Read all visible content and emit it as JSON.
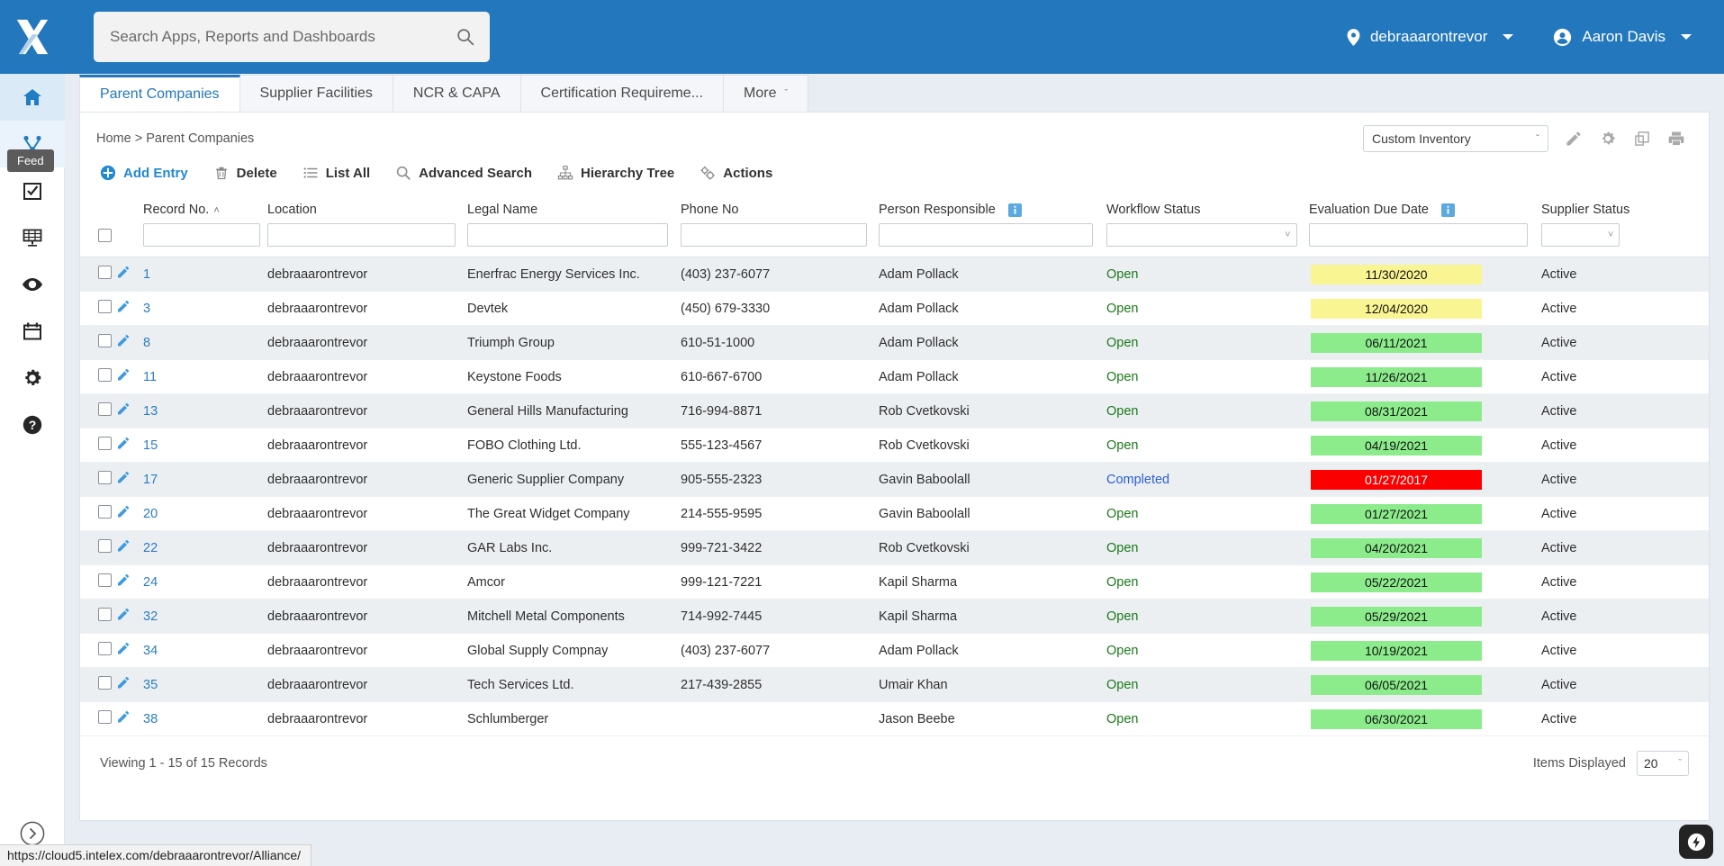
{
  "header": {
    "logo": "x-logo",
    "search": {
      "placeholder": "Search Apps, Reports and Dashboards",
      "value": "",
      "icon": "search-icon"
    },
    "tenant": {
      "label": "debraaarontrevor",
      "icon": "location-pin-icon"
    },
    "user": {
      "label": "Aaron Davis",
      "icon": "user-circle-icon"
    }
  },
  "sidebar": {
    "items": [
      {
        "name": "home",
        "icon": "home-icon",
        "state": "active"
      },
      {
        "name": "feed",
        "icon": "branch-icon",
        "state": "hovered"
      },
      {
        "name": "tasks",
        "icon": "checkbox-icon",
        "state": "default"
      },
      {
        "name": "dashboards",
        "icon": "dashboard-grid-icon",
        "state": "default"
      },
      {
        "name": "views",
        "icon": "eye-icon",
        "state": "default"
      },
      {
        "name": "calendar",
        "icon": "calendar-icon",
        "state": "default"
      },
      {
        "name": "settings",
        "icon": "gear-icon",
        "state": "default"
      },
      {
        "name": "help",
        "icon": "question-circle-icon",
        "state": "default"
      }
    ],
    "tooltip": "Feed",
    "collapse_icon": "chevron-right-circle-icon"
  },
  "tabs": [
    {
      "label": "Parent Companies",
      "active": true
    },
    {
      "label": "Supplier Facilities",
      "active": false
    },
    {
      "label": "NCR & CAPA",
      "active": false
    },
    {
      "label": "Certification Requireme...",
      "active": false
    },
    {
      "label": "More",
      "active": false,
      "chevron": "ˇ"
    }
  ],
  "breadcrumb": "Home > Parent Companies",
  "view_selector": {
    "value": "Custom Inventory",
    "chevron": "ˇ"
  },
  "view_icons": [
    {
      "name": "edit-pencil-icon"
    },
    {
      "name": "gear-icon"
    },
    {
      "name": "copy-icon"
    },
    {
      "name": "print-icon"
    }
  ],
  "toolbar": [
    {
      "label": "Add Entry",
      "icon": "plus-circle-icon",
      "accent": true
    },
    {
      "label": "Delete",
      "icon": "trash-icon",
      "accent": false
    },
    {
      "label": "List All",
      "icon": "list-icon",
      "accent": false
    },
    {
      "label": "Advanced Search",
      "icon": "magnifier-icon",
      "accent": false
    },
    {
      "label": "Hierarchy Tree",
      "icon": "hierarchy-icon",
      "accent": false
    },
    {
      "label": "Actions",
      "icon": "actions-gears-icon",
      "accent": false
    }
  ],
  "table": {
    "columns": [
      {
        "label": "Record No.",
        "sort": "˄",
        "filter": "text",
        "info": false
      },
      {
        "label": "Location",
        "filter": "text",
        "info": false
      },
      {
        "label": "Legal Name",
        "filter": "text",
        "info": false
      },
      {
        "label": "Phone No",
        "filter": "text",
        "info": false
      },
      {
        "label": "Person Responsible",
        "filter": "text",
        "info": true
      },
      {
        "label": "Workflow Status",
        "filter": "select",
        "info": false
      },
      {
        "label": "Evaluation Due Date",
        "filter": "text",
        "info": true
      },
      {
        "label": "Supplier Status",
        "filter": "select",
        "info": false
      }
    ],
    "filter_values": [
      "",
      "",
      "",
      "",
      "",
      "",
      "",
      ""
    ],
    "rows": [
      {
        "record_no": "1",
        "location": "debraaarontrevor",
        "legal_name": "Enerfrac Energy Services Inc.",
        "phone": "(403) 237-6077",
        "person": "Adam Pollack",
        "workflow": "Open",
        "due_date": "11/30/2020",
        "due_color": "yellow",
        "supplier_status": "Active"
      },
      {
        "record_no": "3",
        "location": "debraaarontrevor",
        "legal_name": "Devtek",
        "phone": "(450) 679-3330",
        "person": "Adam Pollack",
        "workflow": "Open",
        "due_date": "12/04/2020",
        "due_color": "yellow",
        "supplier_status": "Active"
      },
      {
        "record_no": "8",
        "location": "debraaarontrevor",
        "legal_name": "Triumph Group",
        "phone": "610-51-1000",
        "person": "Adam Pollack",
        "workflow": "Open",
        "due_date": "06/11/2021",
        "due_color": "green",
        "supplier_status": "Active"
      },
      {
        "record_no": "11",
        "location": "debraaarontrevor",
        "legal_name": "Keystone Foods",
        "phone": "610-667-6700",
        "person": "Adam Pollack",
        "workflow": "Open",
        "due_date": "11/26/2021",
        "due_color": "green",
        "supplier_status": "Active"
      },
      {
        "record_no": "13",
        "location": "debraaarontrevor",
        "legal_name": "General Hills Manufacturing",
        "phone": "716-994-8871",
        "person": "Rob Cvetkovski",
        "workflow": "Open",
        "due_date": "08/31/2021",
        "due_color": "green",
        "supplier_status": "Active"
      },
      {
        "record_no": "15",
        "location": "debraaarontrevor",
        "legal_name": "FOBO Clothing Ltd.",
        "phone": "555-123-4567",
        "person": "Rob Cvetkovski",
        "workflow": "Open",
        "due_date": "04/19/2021",
        "due_color": "green",
        "supplier_status": "Active"
      },
      {
        "record_no": "17",
        "location": "debraaarontrevor",
        "legal_name": "Generic Supplier Company",
        "phone": "905-555-2323",
        "person": "Gavin Baboolall",
        "workflow": "Completed",
        "due_date": "01/27/2017",
        "due_color": "red",
        "supplier_status": "Active"
      },
      {
        "record_no": "20",
        "location": "debraaarontrevor",
        "legal_name": "The Great Widget Company",
        "phone": "214-555-9595",
        "person": "Gavin Baboolall",
        "workflow": "Open",
        "due_date": "01/27/2021",
        "due_color": "green",
        "supplier_status": "Active"
      },
      {
        "record_no": "22",
        "location": "debraaarontrevor",
        "legal_name": "GAR Labs Inc.",
        "phone": "999-721-3422",
        "person": "Rob Cvetkovski",
        "workflow": "Open",
        "due_date": "04/20/2021",
        "due_color": "green",
        "supplier_status": "Active"
      },
      {
        "record_no": "24",
        "location": "debraaarontrevor",
        "legal_name": "Amcor",
        "phone": "999-121-7221",
        "person": "Kapil Sharma",
        "workflow": "Open",
        "due_date": "05/22/2021",
        "due_color": "green",
        "supplier_status": "Active"
      },
      {
        "record_no": "32",
        "location": "debraaarontrevor",
        "legal_name": "Mitchell Metal Components",
        "phone": "714-992-7445",
        "person": "Kapil Sharma",
        "workflow": "Open",
        "due_date": "05/29/2021",
        "due_color": "green",
        "supplier_status": "Active"
      },
      {
        "record_no": "34",
        "location": "debraaarontrevor",
        "legal_name": "Global Supply Compnay",
        "phone": "(403) 237-6077",
        "person": "Adam Pollack",
        "workflow": "Open",
        "due_date": "10/19/2021",
        "due_color": "green",
        "supplier_status": "Active"
      },
      {
        "record_no": "35",
        "location": "debraaarontrevor",
        "legal_name": "Tech Services Ltd.",
        "phone": "217-439-2855",
        "person": "Umair Khan",
        "workflow": "Open",
        "due_date": "06/05/2021",
        "due_color": "green",
        "supplier_status": "Active"
      },
      {
        "record_no": "38",
        "location": "debraaarontrevor",
        "legal_name": "Schlumberger",
        "phone": "",
        "person": "Jason Beebe",
        "workflow": "Open",
        "due_date": "06/30/2021",
        "due_color": "green",
        "supplier_status": "Active"
      }
    ]
  },
  "footer": {
    "viewing": "Viewing 1 - 15 of 15 Records",
    "items_label": "Items Displayed",
    "items_value": "20",
    "items_chevron": "ˇ"
  },
  "status_url": "https://cloud5.intelex.com/debraaarontrevor/Alliance/",
  "fab": {
    "icon": "flash-icon"
  },
  "colors": {
    "brand_blue": "#2277bd",
    "link_blue": "#2c7dc4",
    "chip_yellow": "#faf593",
    "chip_green": "#8cec8c",
    "chip_red": "#fb0000",
    "status_open": "#1a7a1a",
    "status_completed": "#2a5fd6"
  }
}
